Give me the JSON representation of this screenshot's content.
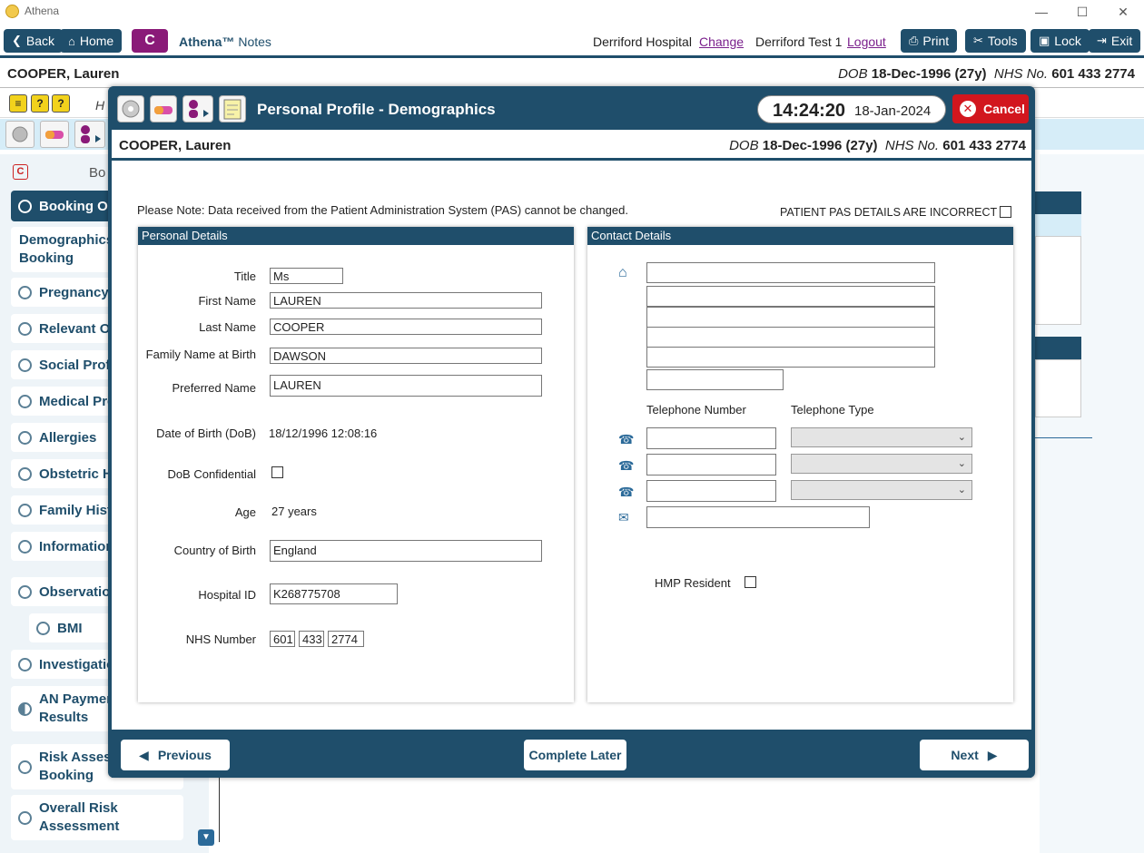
{
  "window": {
    "title": "Athena",
    "minimize": "—",
    "maximize": "☐",
    "close": "✕"
  },
  "toolbar": {
    "back": "Back",
    "home": "Home",
    "c_label": "C",
    "brand": "Athena™",
    "brand_sub": "Notes",
    "hospital": "Derriford Hospital",
    "change": "Change",
    "user": "Derriford Test 1",
    "logout": "Logout",
    "print": "Print",
    "tools": "Tools",
    "lock": "Lock",
    "exit": "Exit"
  },
  "patient": {
    "name": "COOPER, Lauren",
    "dob_label": "DOB",
    "dob": "18-Dec-1996 (27y)",
    "nhs_label": "NHS No.",
    "nhs": "601 433 2774"
  },
  "background": {
    "bar2_text": "H",
    "panel_heading": "Bo"
  },
  "sidebar": {
    "items": [
      {
        "label": "Booking Ov",
        "active": true
      },
      {
        "label": "Demographics Booking"
      },
      {
        "label": "Pregnancy I"
      },
      {
        "label": "Relevant Ot"
      },
      {
        "label": "Social Profil"
      },
      {
        "label": "Medical Pro"
      },
      {
        "label": "Allergies"
      },
      {
        "label": "Obstetric H"
      },
      {
        "label": "Family Histo"
      },
      {
        "label": "Information"
      },
      {
        "label": "Observation"
      },
      {
        "label": "BMI"
      },
      {
        "label": "Investigatio"
      },
      {
        "label": "AN Paymen Results"
      },
      {
        "label": "Risk Assess Booking"
      },
      {
        "label": "Overall Risk Assessment"
      }
    ]
  },
  "modal": {
    "title": "Personal Profile - Demographics",
    "time": "14:24:20",
    "date": "18-Jan-2024",
    "cancel": "Cancel",
    "note": "Please Note:  Data received from the Patient Administration System (PAS) cannot be changed.",
    "pas_incorrect": "PATIENT PAS DETAILS ARE INCORRECT",
    "personal": {
      "heading": "Personal Details",
      "title_label": "Title",
      "title": "Ms",
      "first_label": "First Name",
      "first": "LAUREN",
      "last_label": "Last Name",
      "last": "COOPER",
      "birthname_label": "Family Name at Birth",
      "birthname": "DAWSON",
      "preferred_label": "Preferred Name",
      "preferred": "LAUREN",
      "dob_label": "Date of Birth (DoB)",
      "dob": "18/12/1996 12:08:16",
      "dobconf_label": "DoB Confidential",
      "age_label": "Age",
      "age": "27 years",
      "country_label": "Country of Birth",
      "country": "England",
      "hospid_label": "Hospital ID",
      "hospid": "K268775708",
      "nhs_label": "NHS Number",
      "nhs1": "601",
      "nhs2": "433",
      "nhs3": "2774"
    },
    "contact": {
      "heading": "Contact Details",
      "tel_label": "Telephone Number",
      "type_label": "Telephone Type",
      "hmp_label": "HMP Resident"
    },
    "footer": {
      "previous": "Previous",
      "complete": "Complete Later",
      "next": "Next"
    }
  }
}
